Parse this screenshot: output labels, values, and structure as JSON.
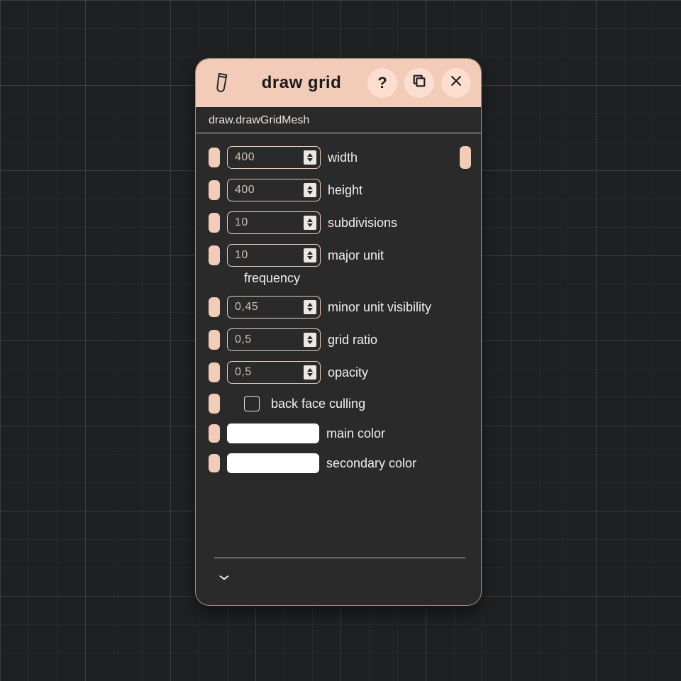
{
  "colors": {
    "accent": "#f2ccb8",
    "panel_bg": "#2b2a2a",
    "text": "#f3efec"
  },
  "header": {
    "title": "draw grid",
    "icon_name": "brush-icon",
    "help_label": "?",
    "duplicate_name": "duplicate-icon",
    "close_name": "close-icon"
  },
  "subheader": "draw.drawGridMesh",
  "fields": {
    "width": {
      "value": "400",
      "label": "width"
    },
    "height": {
      "value": "400",
      "label": "height"
    },
    "subdivisions": {
      "value": "10",
      "label": "subdivisions"
    },
    "major_unit_frequency": {
      "value": "10",
      "label_a": "major unit",
      "label_b": "frequency"
    },
    "minor_unit_visibility": {
      "value": "0,45",
      "label": "minor unit visibility"
    },
    "grid_ratio": {
      "value": "0,5",
      "label": "grid ratio"
    },
    "opacity": {
      "value": "0,5",
      "label": "opacity"
    },
    "back_face_culling": {
      "checked": false,
      "label": "back face culling"
    },
    "main_color": {
      "swatch": "#ffffff",
      "label": "main color"
    },
    "secondary_color": {
      "swatch": "#ffffff",
      "label": "secondary color"
    }
  }
}
